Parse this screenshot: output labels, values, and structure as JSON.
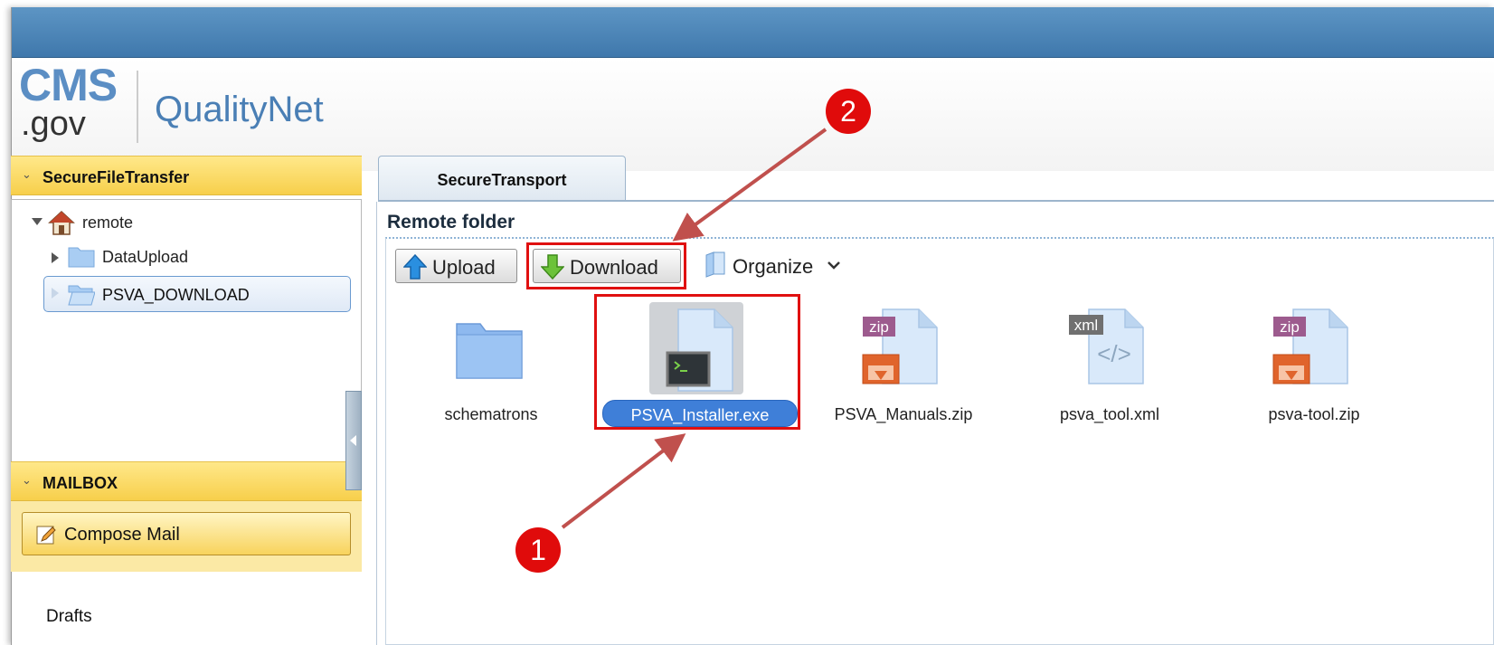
{
  "brand": {
    "logo_top": "CMS",
    "logo_bottom": ".gov",
    "product": "QualityNet"
  },
  "sidebar": {
    "file_panel_title": "SecureFileTransfer",
    "tree": [
      {
        "label": "remote",
        "icon": "home-icon"
      },
      {
        "label": "DataUpload",
        "icon": "folder-icon"
      },
      {
        "label": "PSVA_DOWNLOAD",
        "icon": "open-folder-icon",
        "selected": true
      }
    ],
    "mail_panel_title": "MAILBOX",
    "compose_label": "Compose Mail",
    "drafts_label": "Drafts"
  },
  "tab": {
    "label": "SecureTransport"
  },
  "main": {
    "folder_title": "Remote folder",
    "toolbar": {
      "upload_label": "Upload",
      "download_label": "Download",
      "organize_label": "Organize"
    },
    "files": [
      {
        "name": "schematrons",
        "type": "folder"
      },
      {
        "name": "PSVA_Installer.exe",
        "type": "executable",
        "selected": true
      },
      {
        "name": "PSVA_Manuals.zip",
        "type": "zip",
        "badge": "zip"
      },
      {
        "name": "psva_tool.xml",
        "type": "xml",
        "badge": "xml"
      },
      {
        "name": "psva-tool.zip",
        "type": "zip",
        "badge": "zip"
      }
    ]
  },
  "annotations": {
    "step1": "1",
    "step2": "2"
  },
  "colors": {
    "header": "#4a82b6",
    "panel_header": "#f7cf4b",
    "selection": "#3f7fd8",
    "callout": "#e00b0b"
  }
}
